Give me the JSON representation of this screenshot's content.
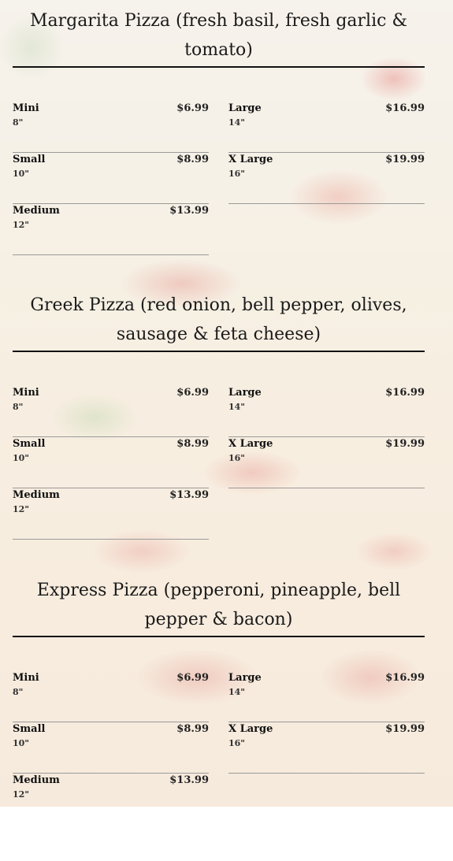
{
  "sections": [
    {
      "title": "Margarita Pizza (fresh basil, fresh garlic & tomato)",
      "items": [
        {
          "name": "Mini",
          "size": "8\"",
          "price": "$6.99"
        },
        {
          "name": "Large",
          "size": "14\"",
          "price": "$16.99"
        },
        {
          "name": "Small",
          "size": "10\"",
          "price": "$8.99"
        },
        {
          "name": "X Large",
          "size": "16\"",
          "price": "$19.99"
        },
        {
          "name": "Medium",
          "size": "12\"",
          "price": "$13.99"
        }
      ]
    },
    {
      "title": "Greek Pizza (red onion, bell pepper, olives, sausage & feta cheese)",
      "items": [
        {
          "name": "Mini",
          "size": "8\"",
          "price": "$6.99"
        },
        {
          "name": "Large",
          "size": "14\"",
          "price": "$16.99"
        },
        {
          "name": "Small",
          "size": "10\"",
          "price": "$8.99"
        },
        {
          "name": "X Large",
          "size": "16\"",
          "price": "$19.99"
        },
        {
          "name": "Medium",
          "size": "12\"",
          "price": "$13.99"
        }
      ]
    },
    {
      "title": "Express Pizza (pepperoni, pineapple, bell pepper & bacon)",
      "items": [
        {
          "name": "Mini",
          "size": "8\"",
          "price": "$6.99"
        },
        {
          "name": "Large",
          "size": "14\"",
          "price": "$16.99"
        },
        {
          "name": "Small",
          "size": "10\"",
          "price": "$8.99"
        },
        {
          "name": "X Large",
          "size": "16\"",
          "price": "$19.99"
        },
        {
          "name": "Medium",
          "size": "12\"",
          "price": "$13.99"
        }
      ]
    }
  ]
}
